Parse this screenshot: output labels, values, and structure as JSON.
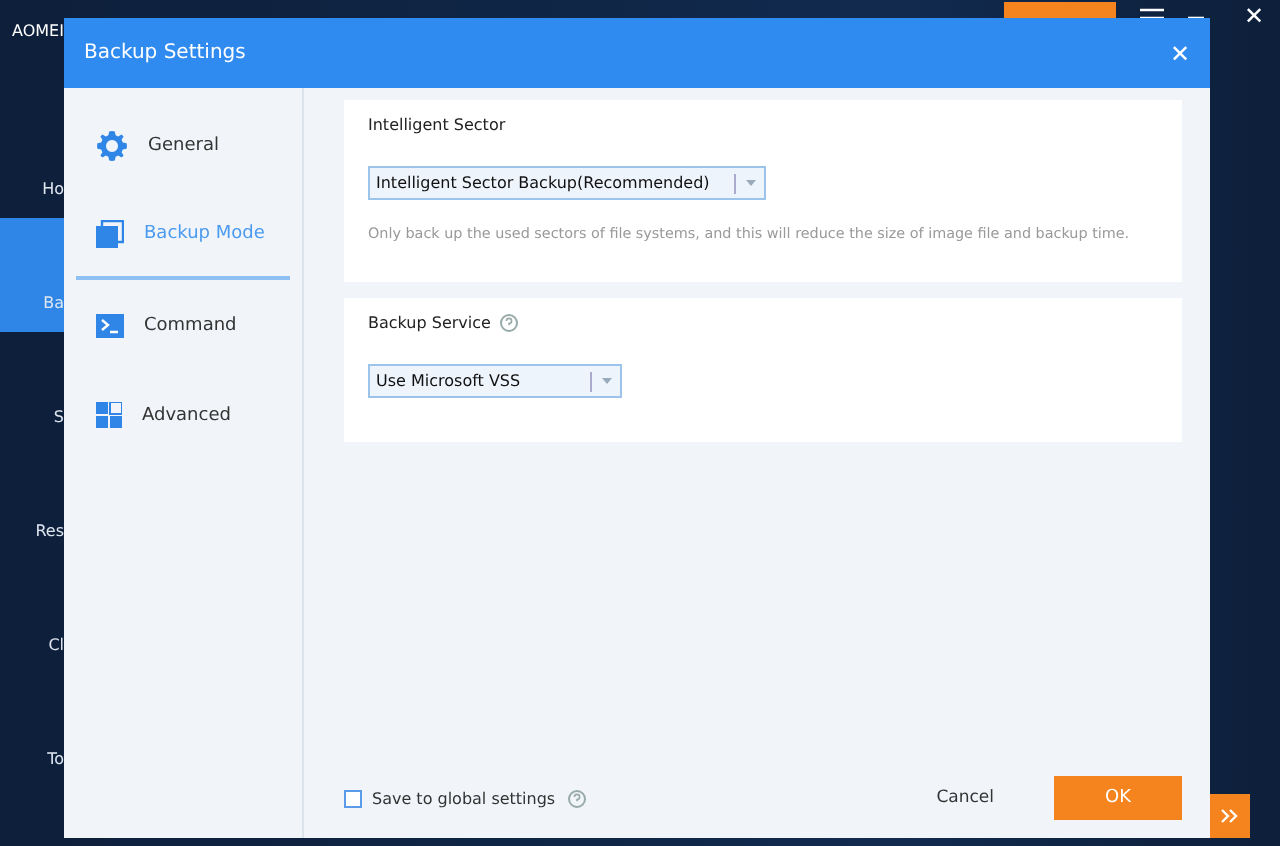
{
  "app": {
    "title": "AOMEI",
    "sidebar": [
      {
        "label": "Ho",
        "selected": false
      },
      {
        "label": "Ba",
        "selected": true
      },
      {
        "label": "S",
        "selected": false
      },
      {
        "label": "Res",
        "selected": false
      },
      {
        "label": "Cl",
        "selected": false
      },
      {
        "label": "To",
        "selected": false
      }
    ],
    "close": "✕"
  },
  "dialog": {
    "title": "Backup Settings",
    "close": "✕",
    "nav": [
      {
        "label": "General",
        "selected": false
      },
      {
        "label": "Backup Mode",
        "selected": true
      },
      {
        "label": "Command",
        "selected": false
      },
      {
        "label": "Advanced",
        "selected": false
      }
    ],
    "sections": [
      {
        "title": "Intelligent Sector",
        "help": false,
        "dropdown": "Intelligent Sector Backup(Recommended)",
        "description": "Only back up the used sectors of file systems, and this will reduce the size of image file and backup time."
      },
      {
        "title": "Backup Service",
        "help": true,
        "dropdown": "Use Microsoft VSS"
      }
    ],
    "footer": {
      "save_global": {
        "label": "Save to global settings",
        "checked": false
      },
      "cancel": "Cancel",
      "ok": "OK"
    }
  }
}
